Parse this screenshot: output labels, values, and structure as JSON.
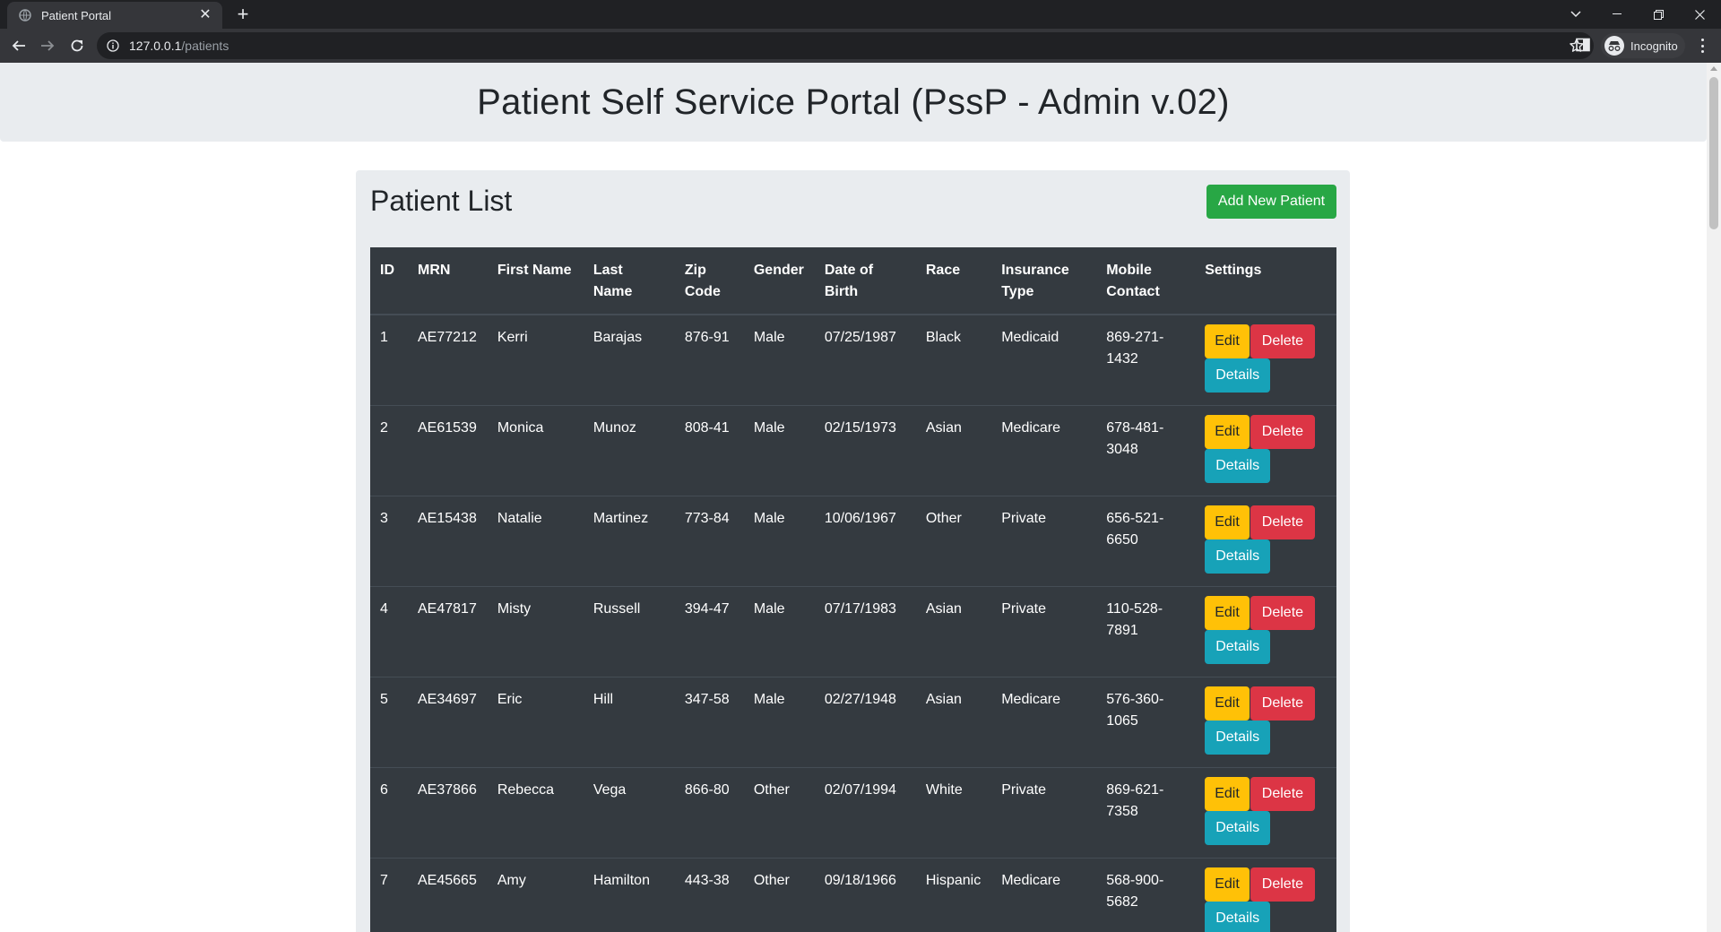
{
  "browser": {
    "tab_title": "Patient Portal",
    "url_host": "127.0.0.1",
    "url_path": "/patients",
    "profile_label": "Incognito"
  },
  "page": {
    "heading": "Patient Self Service Portal (PssP - Admin v.02)"
  },
  "patient_list": {
    "title": "Patient List",
    "add_button": "Add New Patient",
    "columns": [
      "ID",
      "MRN",
      "First Name",
      "Last Name",
      "Zip Code",
      "Gender",
      "Date of Birth",
      "Race",
      "Insurance Type",
      "Mobile Contact",
      "Settings"
    ],
    "actions": {
      "edit": "Edit",
      "delete": "Delete",
      "details": "Details"
    },
    "rows": [
      {
        "id": "1",
        "mrn": "AE77212",
        "first_name": "Kerri",
        "last_name": "Barajas",
        "zip": "876-91",
        "gender": "Male",
        "dob": "07/25/1987",
        "race": "Black",
        "insurance": "Medicaid",
        "mobile": "869-271-1432"
      },
      {
        "id": "2",
        "mrn": "AE61539",
        "first_name": "Monica",
        "last_name": "Munoz",
        "zip": "808-41",
        "gender": "Male",
        "dob": "02/15/1973",
        "race": "Asian",
        "insurance": "Medicare",
        "mobile": "678-481-3048"
      },
      {
        "id": "3",
        "mrn": "AE15438",
        "first_name": "Natalie",
        "last_name": "Martinez",
        "zip": "773-84",
        "gender": "Male",
        "dob": "10/06/1967",
        "race": "Other",
        "insurance": "Private",
        "mobile": "656-521-6650"
      },
      {
        "id": "4",
        "mrn": "AE47817",
        "first_name": "Misty",
        "last_name": "Russell",
        "zip": "394-47",
        "gender": "Male",
        "dob": "07/17/1983",
        "race": "Asian",
        "insurance": "Private",
        "mobile": "110-528-7891"
      },
      {
        "id": "5",
        "mrn": "AE34697",
        "first_name": "Eric",
        "last_name": "Hill",
        "zip": "347-58",
        "gender": "Male",
        "dob": "02/27/1948",
        "race": "Asian",
        "insurance": "Medicare",
        "mobile": "576-360-1065"
      },
      {
        "id": "6",
        "mrn": "AE37866",
        "first_name": "Rebecca",
        "last_name": "Vega",
        "zip": "866-80",
        "gender": "Other",
        "dob": "02/07/1994",
        "race": "White",
        "insurance": "Private",
        "mobile": "869-621-7358"
      },
      {
        "id": "7",
        "mrn": "AE45665",
        "first_name": "Amy",
        "last_name": "Hamilton",
        "zip": "443-38",
        "gender": "Other",
        "dob": "09/18/1966",
        "race": "Hispanic",
        "insurance": "Medicare",
        "mobile": "568-900-5682"
      }
    ]
  },
  "colors": {
    "success": "#28a745",
    "warning": "#ffc107",
    "danger": "#dc3545",
    "info": "#17a2b8",
    "table_dark": "#343a40",
    "jumbotron": "#e9ecef"
  }
}
